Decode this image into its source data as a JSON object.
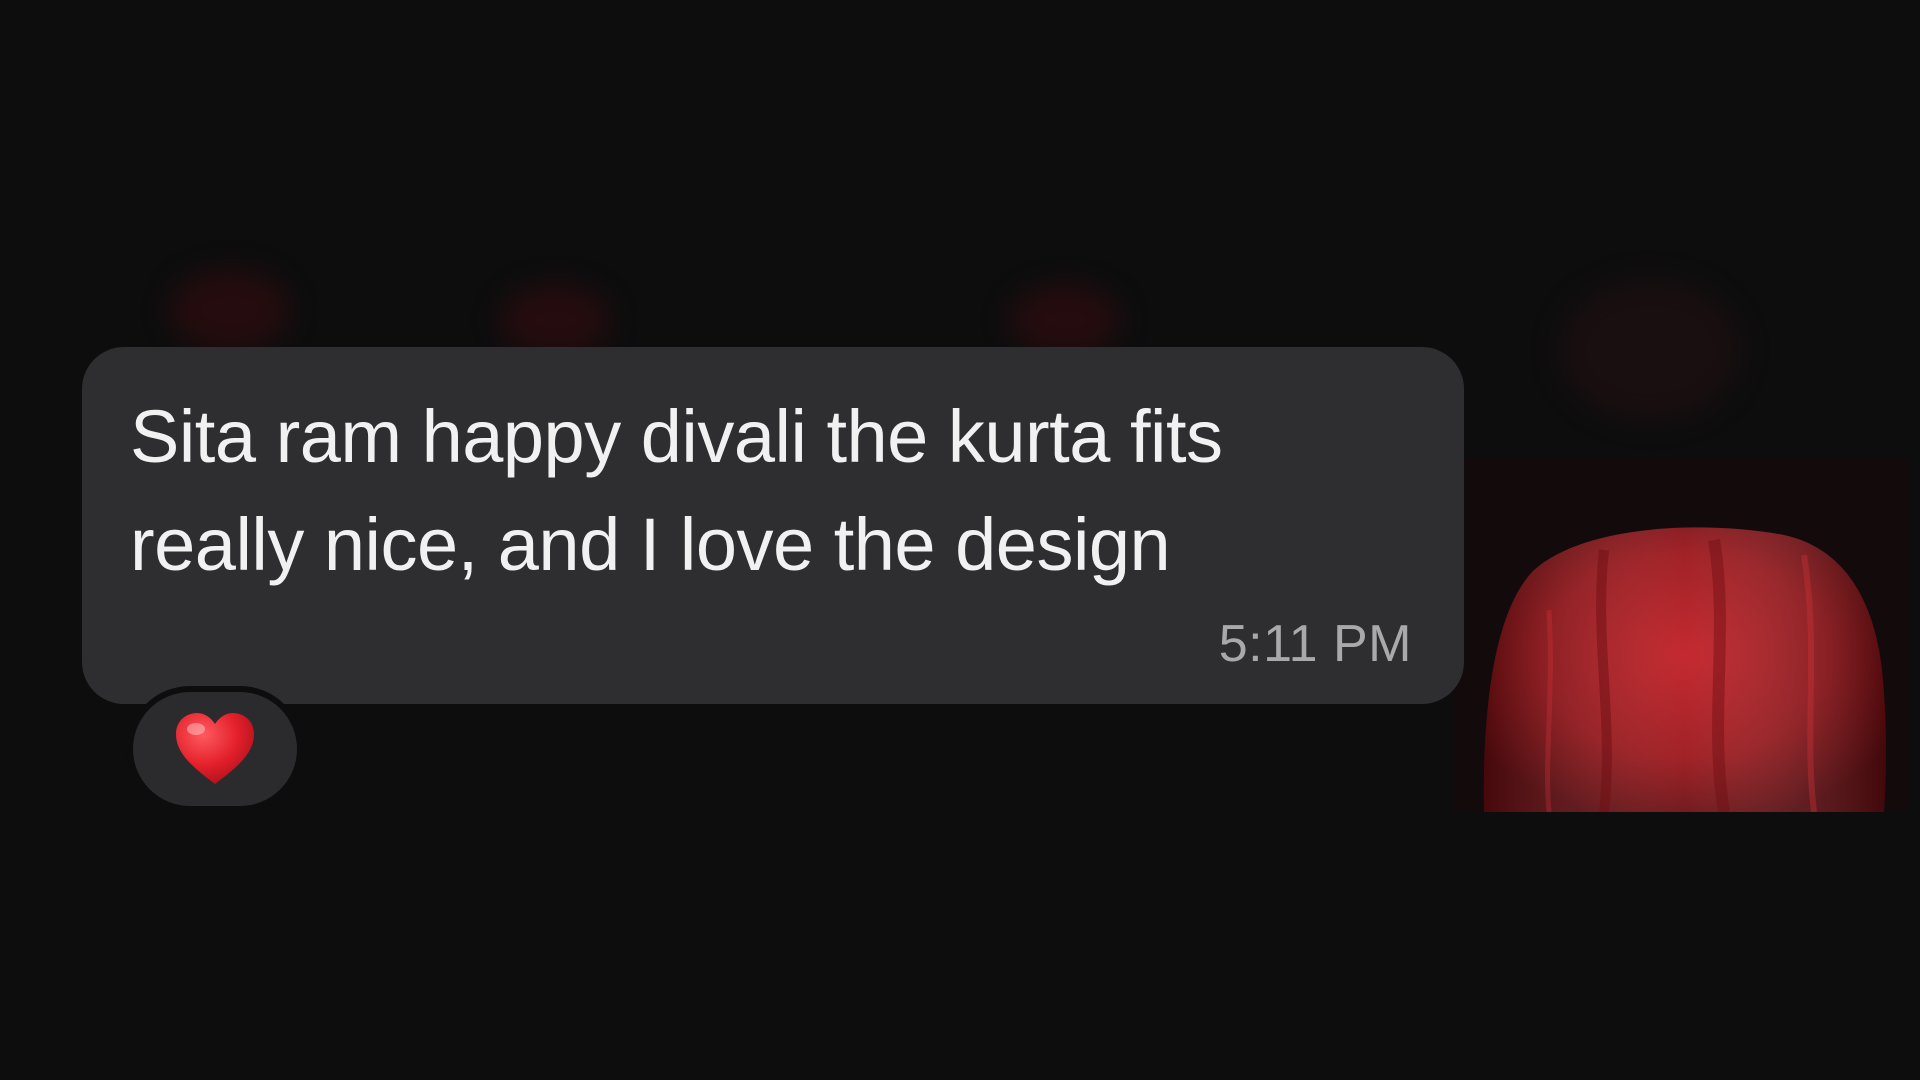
{
  "message": {
    "text_line1": "Sita ram happy divali the kurta fits",
    "text_line2": "really nice, and I love the design",
    "timestamp": "5:11 PM",
    "bubble_color": "#2e2e30",
    "text_color": "#f1f1f1"
  },
  "reaction": {
    "icon": "red-heart-icon",
    "color": "#e3202b"
  },
  "background": {
    "color": "#0d0d0e",
    "thumbnail_accent": "#b3181e"
  }
}
